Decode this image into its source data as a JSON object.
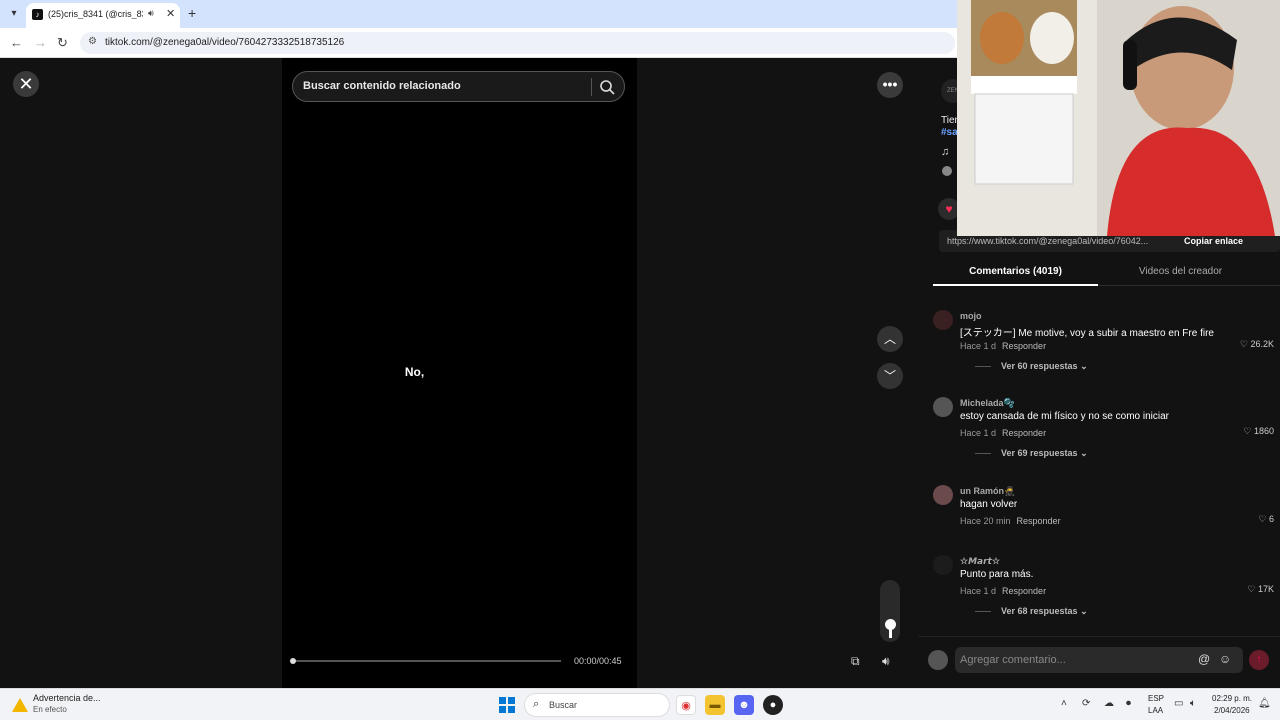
{
  "browser": {
    "tab_title": "(25)cris_8341 (@cris_8341)",
    "url": "tiktok.com/@zenega0al/video/7604273332518735126"
  },
  "viewer": {
    "search_placeholder": "Buscar contenido relacionado",
    "caption": "No,",
    "time": "00:00/00:45",
    "progress_fraction": 0.0
  },
  "post": {
    "desc_partial": "Tien",
    "tag_partial": "#sa",
    "link_url": "https://www.tiktok.com/@zenega0al/video/76042...",
    "copy_label": "Copiar enlace",
    "avatar_text": "ZEN"
  },
  "tabs": {
    "comments": "Comentarios (4019)",
    "creator_videos": "Videos del creador"
  },
  "comments": [
    {
      "user": "mojo",
      "text": "[ステッカー] Me motive, voy a subir a maestro en Fre fire",
      "time": "Hace 1 d",
      "reply": "Responder",
      "likes": "26.2K",
      "more": "Ver 60 respuestas"
    },
    {
      "user": "Michelada🫧",
      "text": "estoy cansada de mi físico y no se como iniciar",
      "time": "Hace 1 d",
      "reply": "Responder",
      "likes": "1860",
      "more": "Ver 69 respuestas"
    },
    {
      "user": "un Ramón🥷",
      "text": "hagan volver",
      "time": "Hace 20 min",
      "reply": "Responder",
      "likes": "6",
      "more": ""
    },
    {
      "user": "☆𝙈𝙖𝙧𝙩☆",
      "text": "Punto para más.",
      "time": "Hace 1 d",
      "reply": "Responder",
      "likes": "17K",
      "more": "Ver 68 respuestas"
    }
  ],
  "composer": {
    "placeholder": "Agregar comentario..."
  },
  "taskbar": {
    "warning_title": "Advertencia de...",
    "warning_sub": "En efecto",
    "search_label": "Buscar",
    "lang1": "ESP",
    "lang2": "LAA",
    "time": "02:29 p. m.",
    "date": "2/04/2026"
  },
  "colors": {
    "accent": "#fe2c55",
    "link": "#69a3ff",
    "windows_blue": "#0078d4"
  }
}
